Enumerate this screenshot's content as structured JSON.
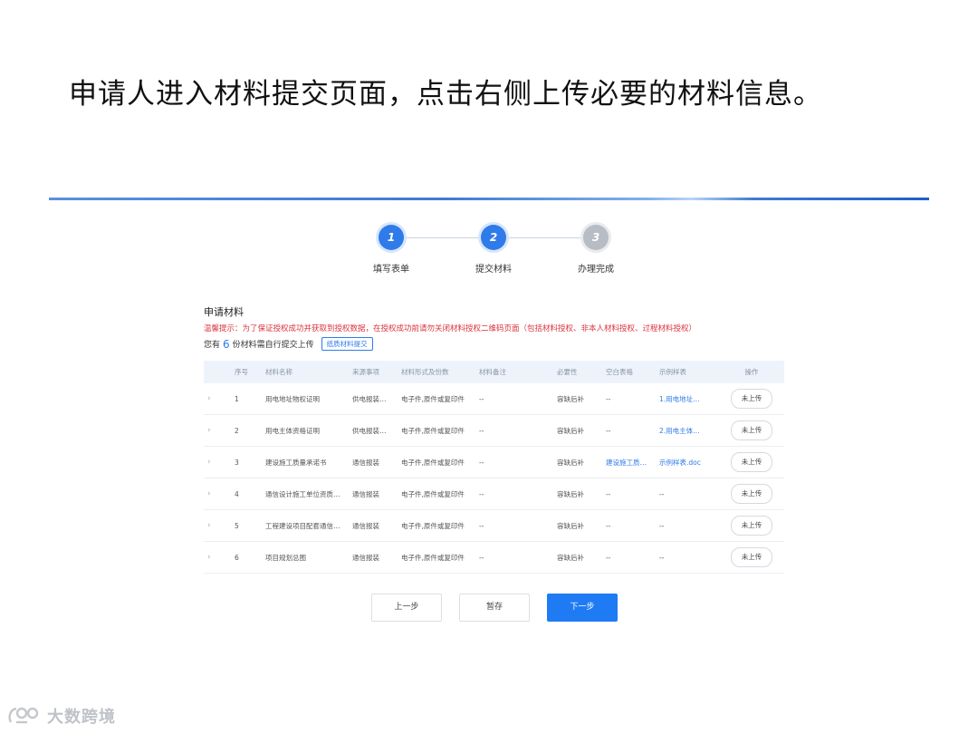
{
  "slide": {
    "title": "申请人进入材料提交页面，点击右侧上传必要的材料信息。"
  },
  "steps": [
    {
      "num": "1",
      "label": "填写表单",
      "state": "active"
    },
    {
      "num": "2",
      "label": "提交材料",
      "state": "active"
    },
    {
      "num": "3",
      "label": "办理完成",
      "state": "inactive"
    }
  ],
  "section": {
    "title": "申请材料",
    "tip": "温馨提示：为了保证授权成功并获取到授权数据，在授权成功前请勿关闭材料授权二维码页面（包括材料授权、非本人材料授权、过程材料授权）",
    "count_prefix": "您有",
    "count": "6",
    "count_suffix": "份材料需自行提交上传",
    "paper_button": "纸质材料提交"
  },
  "table": {
    "headers": [
      "",
      "序号",
      "材料名称",
      "来源事项",
      "材料形式及份数",
      "材料备注",
      "必要性",
      "空白表格",
      "示例样表",
      "操作"
    ],
    "rows": [
      {
        "no": "1",
        "name": "用电地址物权证明",
        "source": "供电报装…",
        "form": "电子件,原件或复印件",
        "note": "--",
        "need": "容缺后补",
        "blank": "--",
        "sample": "1.用电地址…",
        "action": "未上传"
      },
      {
        "no": "2",
        "name": "用电主体资格证明",
        "source": "供电报装…",
        "form": "电子件,原件或复印件",
        "note": "--",
        "need": "容缺后补",
        "blank": "--",
        "sample": "2.用电主体…",
        "action": "未上传"
      },
      {
        "no": "3",
        "name": "建设施工质量承诺书",
        "source": "通信报装",
        "form": "电子件,原件或复印件",
        "note": "--",
        "need": "容缺后补",
        "blank": "建设施工质…",
        "sample": "示例样表.doc",
        "action": "未上传"
      },
      {
        "no": "4",
        "name": "通信设计施工单位资质…",
        "source": "通信报装",
        "form": "电子件,原件或复印件",
        "note": "--",
        "need": "容缺后补",
        "blank": "--",
        "sample": "--",
        "action": "未上传"
      },
      {
        "no": "5",
        "name": "工程建设项目配套通信…",
        "source": "通信报装",
        "form": "电子件,原件或复印件",
        "note": "--",
        "need": "容缺后补",
        "blank": "--",
        "sample": "--",
        "action": "未上传"
      },
      {
        "no": "6",
        "name": "项目规划总图",
        "source": "通信报装",
        "form": "电子件,原件或复印件",
        "note": "--",
        "need": "容缺后补",
        "blank": "--",
        "sample": "--",
        "action": "未上传"
      }
    ]
  },
  "footer": {
    "prev": "上一步",
    "save": "暂存",
    "next": "下一步"
  },
  "logo": {
    "text": "大数跨境"
  },
  "colors": {
    "primary": "#2f7bea",
    "tip_red": "#d9343d",
    "inactive_step": "#b8bcc4"
  }
}
